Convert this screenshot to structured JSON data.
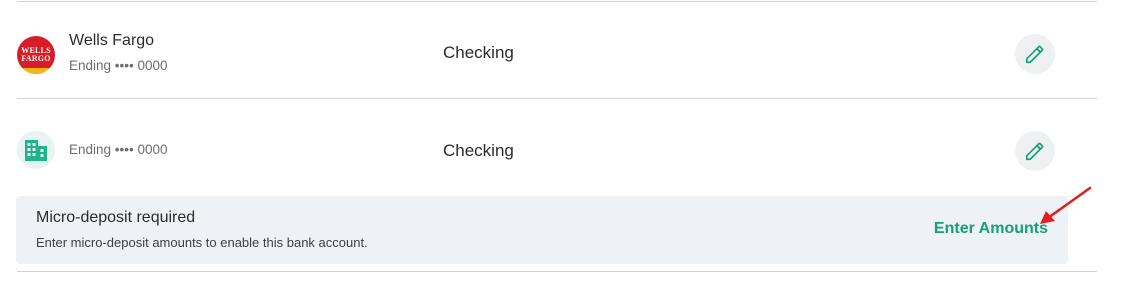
{
  "accounts": [
    {
      "bank_name": "Wells Fargo",
      "logo_text": [
        "WELLS",
        "FARGO"
      ],
      "ending": "Ending •••• 0000",
      "type": "Checking"
    },
    {
      "bank_name": "",
      "ending": "Ending •••• 0000",
      "type": "Checking"
    }
  ],
  "notice": {
    "title": "Micro-deposit required",
    "description": "Enter micro-deposit amounts to enable this bank account.",
    "action_label": "Enter Amounts"
  },
  "colors": {
    "accent": "#16a07a",
    "wells_fargo_red": "#d71e28",
    "wells_fargo_gold": "#f5b51a",
    "notice_bg": "#eef2f6",
    "annotation_arrow": "#e0201f"
  },
  "icons": {
    "edit": "pencil-icon",
    "generic_bank": "building-icon"
  }
}
